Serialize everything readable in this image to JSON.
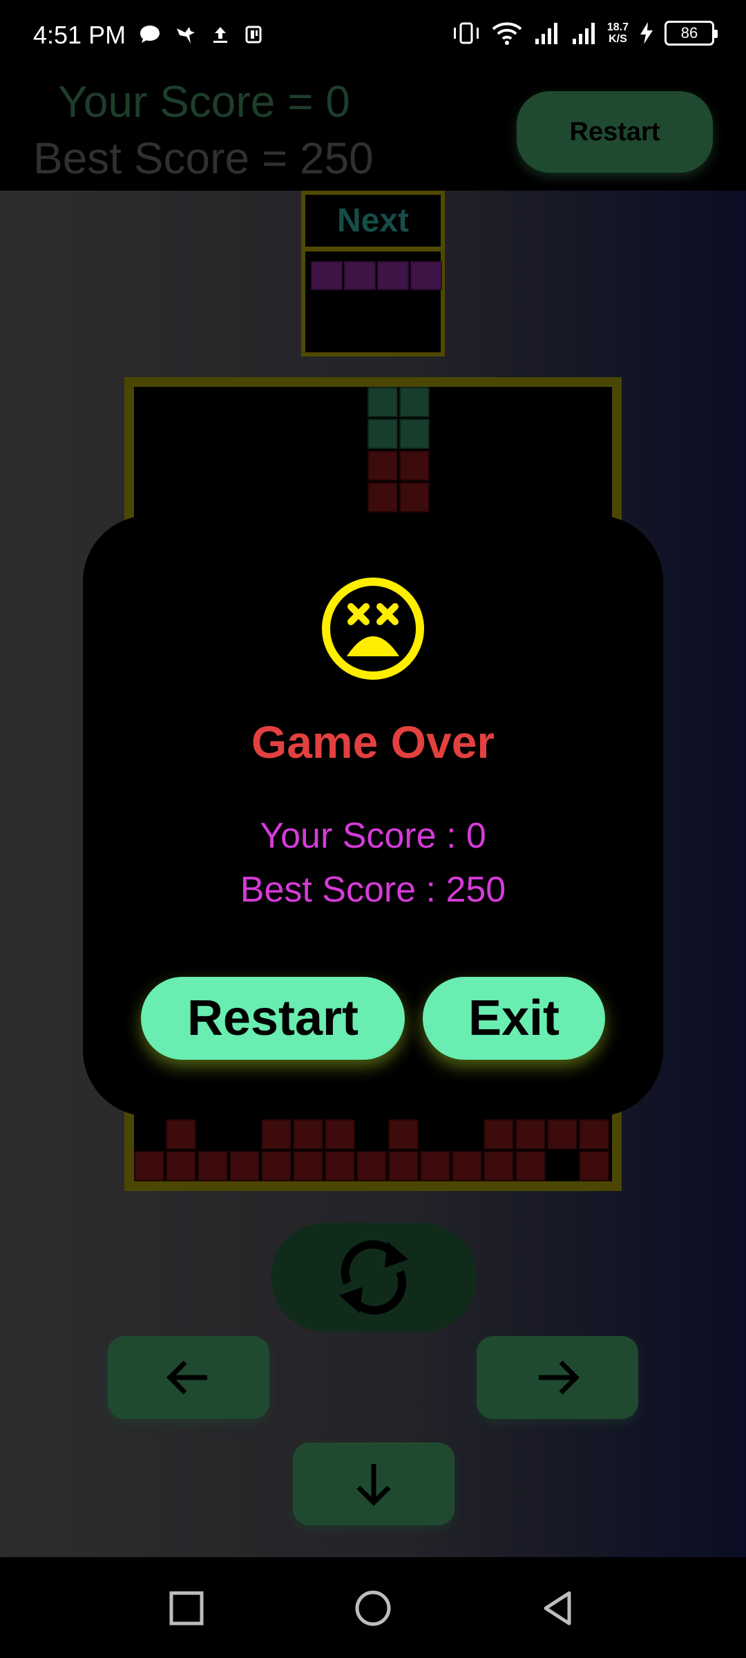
{
  "status_bar": {
    "time": "4:51 PM",
    "speed_top": "18.7",
    "speed_bottom": "K/S",
    "battery": "86",
    "icons_left": [
      "chat-icon",
      "hummingbird-icon",
      "upload-icon",
      "nfc-icon"
    ],
    "icons_right": [
      "vibrate-icon",
      "wifi-icon",
      "signal-icon",
      "signal-icon",
      "charging-icon"
    ]
  },
  "header": {
    "your_score": "Your Score = 0",
    "best_score": "Best Score = 250",
    "restart_label": "Restart"
  },
  "next_panel": {
    "title": "Next",
    "piece_color": "#3f1446",
    "piece_cells": 4
  },
  "modal": {
    "icon": "dizzy-face-icon",
    "title": "Game Over",
    "your_score": "Your Score : 0",
    "best_score": "Best Score : 250",
    "restart_label": "Restart",
    "exit_label": "Exit"
  },
  "controls": {
    "rotate": "rotate-icon",
    "left": "arrow-left-icon",
    "right": "arrow-right-icon",
    "down": "arrow-down-icon"
  },
  "nav_bar": {
    "items": [
      "recents-icon",
      "home-icon",
      "back-icon"
    ]
  },
  "colors": {
    "accent_green": "#69edb0",
    "game_over_red": "#e2413f",
    "score_magenta": "#d63bd9",
    "face_yellow": "#ffee00",
    "board_border": "#4b4702"
  }
}
